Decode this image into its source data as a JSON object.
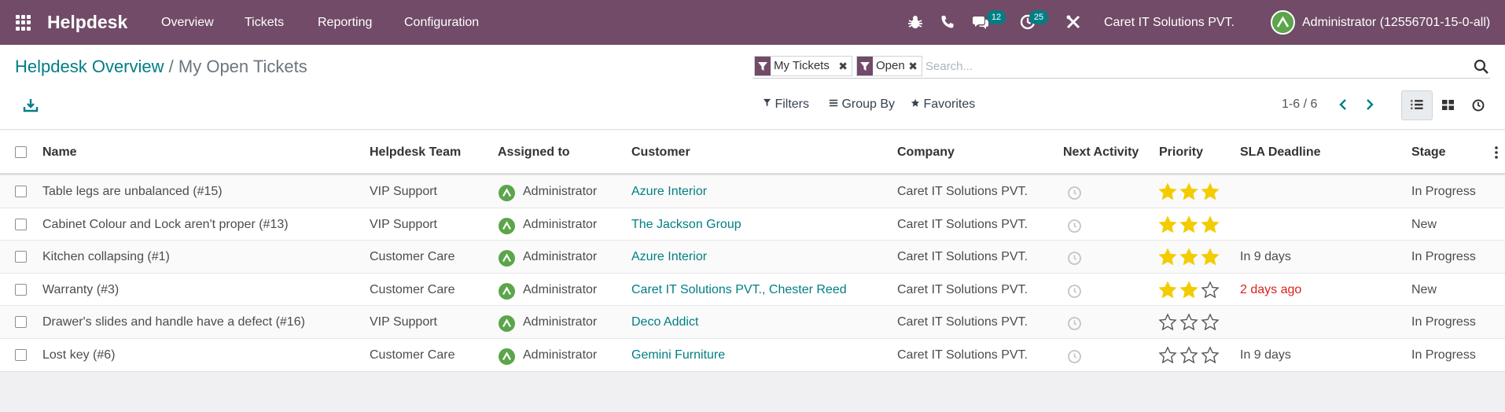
{
  "navbar": {
    "app_name": "Helpdesk",
    "menu": [
      "Overview",
      "Tickets",
      "Reporting",
      "Configuration"
    ],
    "badges": {
      "messages": "12",
      "activities": "25"
    },
    "company": "Caret IT Solutions PVT.",
    "user": "Administrator (12556701-15-0-all)"
  },
  "breadcrumb": {
    "parent": "Helpdesk Overview",
    "separator": "/",
    "current": "My Open Tickets"
  },
  "search": {
    "facets": [
      "My Tickets",
      "Open"
    ],
    "placeholder": "Search..."
  },
  "controls": {
    "filters": "Filters",
    "group_by": "Group By",
    "favorites": "Favorites"
  },
  "pager": {
    "text": "1-6 / 6"
  },
  "table": {
    "columns": [
      "Name",
      "Helpdesk Team",
      "Assigned to",
      "Customer",
      "Company",
      "Next Activity",
      "Priority",
      "SLA Deadline",
      "Stage"
    ],
    "rows": [
      {
        "name": "Table legs are unbalanced (#15)",
        "team": "VIP Support",
        "assigned": "Administrator",
        "customer": "Azure Interior",
        "company": "Caret IT Solutions PVT.",
        "priority": 3,
        "sla": "",
        "sla_overdue": false,
        "stage": "In Progress"
      },
      {
        "name": "Cabinet Colour and Lock aren't proper (#13)",
        "team": "VIP Support",
        "assigned": "Administrator",
        "customer": "The Jackson Group",
        "company": "Caret IT Solutions PVT.",
        "priority": 3,
        "sla": "",
        "sla_overdue": false,
        "stage": "New"
      },
      {
        "name": "Kitchen collapsing (#1)",
        "team": "Customer Care",
        "assigned": "Administrator",
        "customer": "Azure Interior",
        "company": "Caret IT Solutions PVT.",
        "priority": 3,
        "sla": "In 9 days",
        "sla_overdue": false,
        "stage": "In Progress"
      },
      {
        "name": "Warranty (#3)",
        "team": "Customer Care",
        "assigned": "Administrator",
        "customer": "Caret IT Solutions PVT., Chester Reed",
        "company": "Caret IT Solutions PVT.",
        "priority": 2,
        "sla": "2 days ago",
        "sla_overdue": true,
        "stage": "New"
      },
      {
        "name": "Drawer's slides and handle have a defect (#16)",
        "team": "VIP Support",
        "assigned": "Administrator",
        "customer": "Deco Addict",
        "company": "Caret IT Solutions PVT.",
        "priority": 0,
        "sla": "",
        "sla_overdue": false,
        "stage": "In Progress"
      },
      {
        "name": "Lost key (#6)",
        "team": "Customer Care",
        "assigned": "Administrator",
        "customer": "Gemini Furniture",
        "company": "Caret IT Solutions PVT.",
        "priority": 0,
        "sla": "In 9 days",
        "sla_overdue": false,
        "stage": "In Progress"
      }
    ]
  },
  "colors": {
    "brand": "#714b67",
    "link": "#017e84",
    "star_filled": "#f3cc00",
    "overdue": "#d9231c",
    "avatar": "#5ba54a"
  },
  "icons": [
    "apps-icon",
    "bug-icon",
    "phone-icon",
    "chat-icon",
    "clock-icon",
    "tools-icon",
    "filter-icon",
    "search-icon",
    "download-icon",
    "list-view-icon",
    "kanban-view-icon",
    "activity-view-icon"
  ]
}
